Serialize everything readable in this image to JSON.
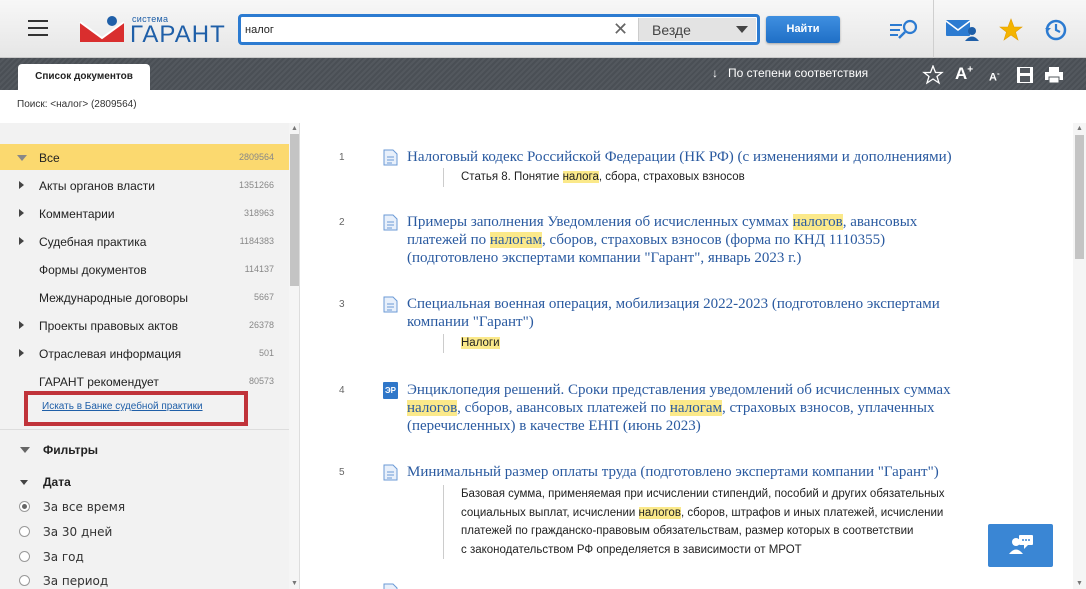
{
  "header": {
    "logo_small": "система",
    "logo_big": "ГАРАНТ",
    "search_value": "налог",
    "scope": "Везде",
    "find_label": "Найти"
  },
  "tabbar": {
    "tab_label": "Список документов",
    "sort_label": "По степени соответствия",
    "font_up": "A",
    "font_up_sup": "+",
    "font_down": "A",
    "font_down_sup": "-"
  },
  "search_info": "Поиск: <налог> (2809564)",
  "tree": [
    {
      "label": "Все",
      "count": "2809564"
    },
    {
      "label": "Акты органов власти",
      "count": "1351266"
    },
    {
      "label": "Комментарии",
      "count": "318963"
    },
    {
      "label": "Судебная практика",
      "count": "1184383"
    },
    {
      "label": "Формы документов",
      "count": "114137"
    },
    {
      "label": "Международные договоры",
      "count": "5667"
    },
    {
      "label": "Проекты правовых актов",
      "count": "26378"
    },
    {
      "label": "Отраслевая информация",
      "count": "501"
    },
    {
      "label": "ГАРАНТ рекомендует",
      "count": "80573"
    }
  ],
  "bank_link": "Искать в Банке судебной практики",
  "filters": {
    "title": "Фильтры",
    "date_title": "Дата",
    "options": [
      "За все время",
      "За 30 дней",
      "За год",
      "За период"
    ]
  },
  "results": [
    {
      "num": "1",
      "title": "Налоговый кодекс Российской Федерации (НК РФ) (с изменениями и дополнениями)",
      "sub_a": "Статья 8. Понятие ",
      "sub_mark": "налога",
      "sub_b": ", сбора, страховых взносов"
    },
    {
      "num": "2",
      "t1": "Примеры заполнения Уведомления об исчисленных суммах ",
      "t1m": "налогов",
      "t1b": ", авансовых",
      "t2": "платежей по ",
      "t2m": "налогам",
      "t2b": ", сборов, страховых взносов (форма по КНД 1110355)",
      "t3": "(подготовлено экспертами компании \"Гарант\", январь 2023 г.)"
    },
    {
      "num": "3",
      "title": "Специальная военная операция, мобилизация 2022-2023 (подготовлено экспертами компании \"Гарант\")",
      "sub_mark": "Налоги"
    },
    {
      "num": "4",
      "icon_text": "ЭР",
      "t1": "Энциклопедия решений. Сроки представления уведомлений об исчисленных суммах",
      "t2m": "налогов",
      "t2": ", сборов, авансовых платежей по ",
      "t2m2": "налогам",
      "t2b": ", страховых взносов, уплаченных",
      "t3": "(перечисленных) в качестве ЕНП (июнь 2023)"
    },
    {
      "num": "5",
      "title": "Минимальный размер оплаты труда (подготовлено экспертами компании \"Гарант\")",
      "l1": "Базовая сумма, применяемая при исчислении стипендий, пособий и других обязательных",
      "l2a": "социальных выплат, исчислении ",
      "l2m": "налогов",
      "l2b": ", сборов, штрафов и иных платежей, исчислении",
      "l3": "платежей по гражданско-правовым обязательствам, размер которых в соответствии",
      "l4": "с законодательством РФ определяется в зависимости от МРОТ"
    }
  ],
  "colors": {
    "accent": "#2c7bd1",
    "selected_bg": "#fbd96f",
    "highlight": "#fbe98a",
    "link": "#2a5aa0",
    "frame": "#c0333a"
  }
}
